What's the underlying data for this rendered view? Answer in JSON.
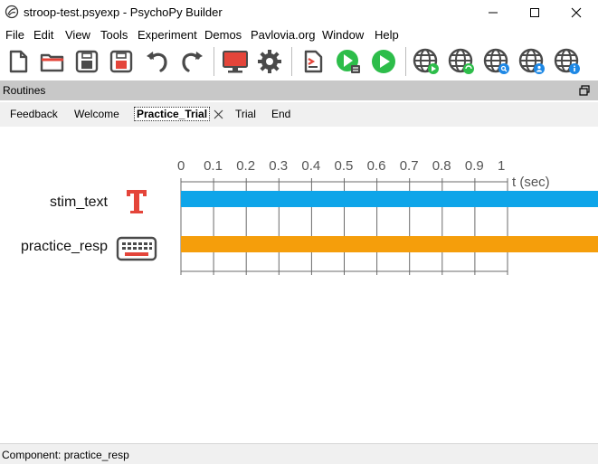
{
  "window": {
    "title": "stroop-test.psyexp - PsychoPy Builder",
    "icon": "psychopy-icon"
  },
  "menu": [
    "File",
    "Edit",
    "View",
    "Tools",
    "Experiment",
    "Demos",
    "Pavlovia.org",
    "Window",
    "Help"
  ],
  "toolbar": {
    "buttons": [
      "new-file-icon",
      "open-folder-icon",
      "save-icon",
      "save-as-icon",
      "undo-icon",
      "redo-icon",
      "monitor-icon",
      "settings-gear-icon",
      "compile-script-icon",
      "run-pilot-icon",
      "run-icon",
      "pavlovia-run-icon",
      "pavlovia-sync-icon",
      "pavlovia-search-icon",
      "pavlovia-user-icon",
      "pavlovia-info-icon"
    ]
  },
  "routines": {
    "header": "Routines",
    "tabs": [
      {
        "label": "Feedback",
        "active": false
      },
      {
        "label": "Welcome",
        "active": false
      },
      {
        "label": "Practice_Trial",
        "active": true
      },
      {
        "label": "Trial",
        "active": false
      },
      {
        "label": "End",
        "active": false
      }
    ]
  },
  "timeline": {
    "ticks": [
      "0",
      "0.1",
      "0.2",
      "0.3",
      "0.4",
      "0.5",
      "0.6",
      "0.7",
      "0.8",
      "0.9",
      "1"
    ],
    "axis_label": "t (sec)",
    "components": [
      {
        "name": "stim_text",
        "icon": "text-component-icon",
        "color": "#0ea5e9",
        "start": 0,
        "stop": null
      },
      {
        "name": "practice_resp",
        "icon": "keyboard-component-icon",
        "color": "#f59e0b",
        "start": 0,
        "stop": null
      }
    ]
  },
  "status": {
    "text": "Component: practice_resp"
  }
}
